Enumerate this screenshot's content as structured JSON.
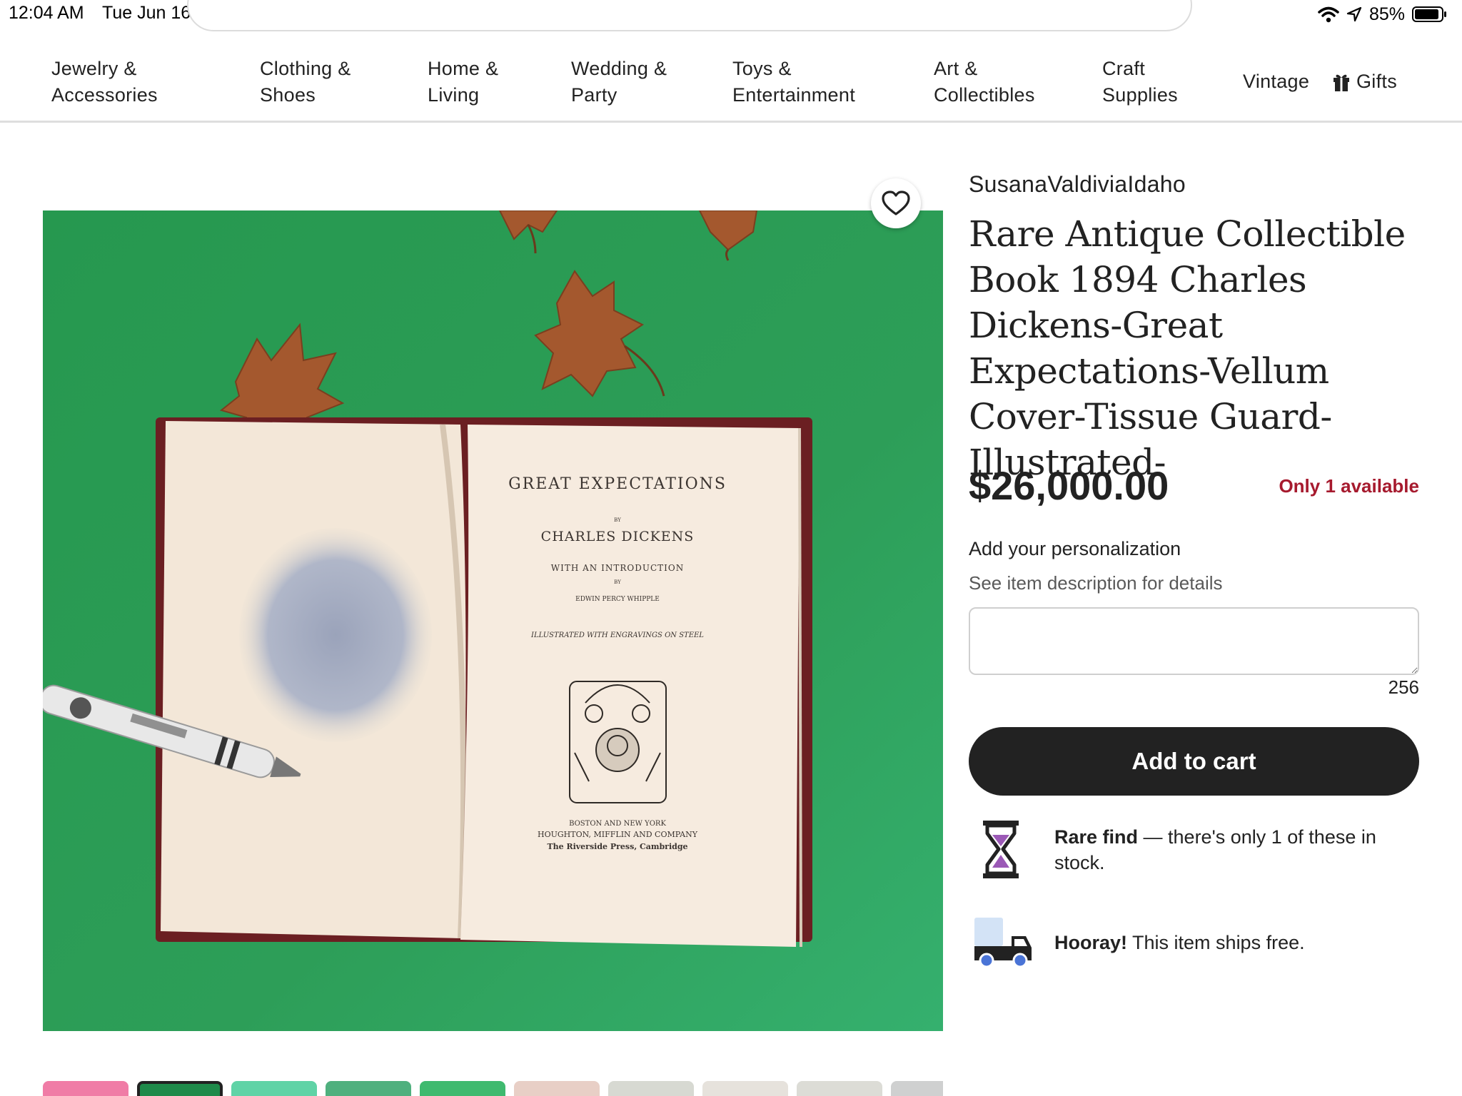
{
  "status_bar": {
    "time": "12:04 AM",
    "date": "Tue Jun 16",
    "battery": "85%"
  },
  "categories": [
    {
      "label_line1": "Jewelry &",
      "label_line2": "Accessories"
    },
    {
      "label_line1": "Clothing &",
      "label_line2": "Shoes"
    },
    {
      "label_line1": "Home &",
      "label_line2": "Living"
    },
    {
      "label_line1": "Wedding &",
      "label_line2": "Party"
    },
    {
      "label_line1": "Toys &",
      "label_line2": "Entertainment"
    },
    {
      "label_line1": "Art &",
      "label_line2": "Collectibles"
    },
    {
      "label_line1": "Craft",
      "label_line2": "Supplies"
    },
    {
      "label_line1": "Vintage"
    },
    {
      "label_line1": "Gifts"
    }
  ],
  "book": {
    "title": "GREAT EXPECTATIONS",
    "by1": "BY",
    "author": "CHARLES DICKENS",
    "intro": "WITH AN INTRODUCTION",
    "by2": "BY",
    "intro_author": "EDWIN PERCY WHIPPLE",
    "illustrated": "ILLUSTRATED WITH ENGRAVINGS ON STEEL",
    "pub1": "BOSTON AND NEW YORK",
    "pub2": "HOUGHTON, MIFFLIN AND COMPANY",
    "pub3": "The Riverside Press, Cambridge"
  },
  "product": {
    "shop_name": "SusanaValdiviaIdaho",
    "title": "Rare Antique Collectible Book 1894 Charles Dickens-Great Expectations-Vellum Cover-Tissue Guard-Illustrated-",
    "price": "$26,000.00",
    "availability": "Only 1 available",
    "personalization_label": "Add your personalization",
    "personalization_hint": "See item description for details",
    "personalization_value": "",
    "char_count": "256",
    "add_to_cart": "Add to cart",
    "rare_find_bold": "Rare find",
    "rare_find_text": " — there's only 1 of these in stock.",
    "shipping_bold": "Hooray!",
    "shipping_text": " This item ships free."
  },
  "colors": {
    "accent_dark": "#222222",
    "availability_red": "#a61a2e",
    "image_green": "#2f9a55",
    "hourglass_purple": "#9b59b6",
    "truck_blue": "#4a74d6"
  },
  "icons": [
    "heart-icon",
    "gift-icon",
    "hourglass-icon",
    "truck-icon",
    "wifi-icon",
    "location-icon",
    "battery-icon"
  ]
}
